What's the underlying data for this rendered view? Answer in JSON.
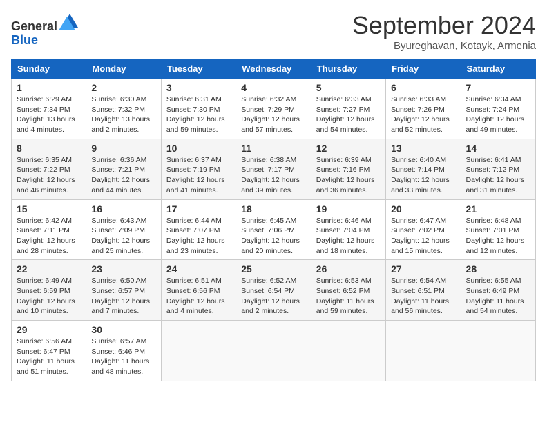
{
  "header": {
    "logo_line1": "General",
    "logo_line2": "Blue",
    "month_year": "September 2024",
    "location": "Byureghavan, Kotayk, Armenia"
  },
  "weekdays": [
    "Sunday",
    "Monday",
    "Tuesday",
    "Wednesday",
    "Thursday",
    "Friday",
    "Saturday"
  ],
  "weeks": [
    [
      {
        "day": "1",
        "sunrise": "6:29 AM",
        "sunset": "7:34 PM",
        "daylight": "13 hours and 4 minutes."
      },
      {
        "day": "2",
        "sunrise": "6:30 AM",
        "sunset": "7:32 PM",
        "daylight": "13 hours and 2 minutes."
      },
      {
        "day": "3",
        "sunrise": "6:31 AM",
        "sunset": "7:30 PM",
        "daylight": "12 hours and 59 minutes."
      },
      {
        "day": "4",
        "sunrise": "6:32 AM",
        "sunset": "7:29 PM",
        "daylight": "12 hours and 57 minutes."
      },
      {
        "day": "5",
        "sunrise": "6:33 AM",
        "sunset": "7:27 PM",
        "daylight": "12 hours and 54 minutes."
      },
      {
        "day": "6",
        "sunrise": "6:33 AM",
        "sunset": "7:26 PM",
        "daylight": "12 hours and 52 minutes."
      },
      {
        "day": "7",
        "sunrise": "6:34 AM",
        "sunset": "7:24 PM",
        "daylight": "12 hours and 49 minutes."
      }
    ],
    [
      {
        "day": "8",
        "sunrise": "6:35 AM",
        "sunset": "7:22 PM",
        "daylight": "12 hours and 46 minutes."
      },
      {
        "day": "9",
        "sunrise": "6:36 AM",
        "sunset": "7:21 PM",
        "daylight": "12 hours and 44 minutes."
      },
      {
        "day": "10",
        "sunrise": "6:37 AM",
        "sunset": "7:19 PM",
        "daylight": "12 hours and 41 minutes."
      },
      {
        "day": "11",
        "sunrise": "6:38 AM",
        "sunset": "7:17 PM",
        "daylight": "12 hours and 39 minutes."
      },
      {
        "day": "12",
        "sunrise": "6:39 AM",
        "sunset": "7:16 PM",
        "daylight": "12 hours and 36 minutes."
      },
      {
        "day": "13",
        "sunrise": "6:40 AM",
        "sunset": "7:14 PM",
        "daylight": "12 hours and 33 minutes."
      },
      {
        "day": "14",
        "sunrise": "6:41 AM",
        "sunset": "7:12 PM",
        "daylight": "12 hours and 31 minutes."
      }
    ],
    [
      {
        "day": "15",
        "sunrise": "6:42 AM",
        "sunset": "7:11 PM",
        "daylight": "12 hours and 28 minutes."
      },
      {
        "day": "16",
        "sunrise": "6:43 AM",
        "sunset": "7:09 PM",
        "daylight": "12 hours and 25 minutes."
      },
      {
        "day": "17",
        "sunrise": "6:44 AM",
        "sunset": "7:07 PM",
        "daylight": "12 hours and 23 minutes."
      },
      {
        "day": "18",
        "sunrise": "6:45 AM",
        "sunset": "7:06 PM",
        "daylight": "12 hours and 20 minutes."
      },
      {
        "day": "19",
        "sunrise": "6:46 AM",
        "sunset": "7:04 PM",
        "daylight": "12 hours and 18 minutes."
      },
      {
        "day": "20",
        "sunrise": "6:47 AM",
        "sunset": "7:02 PM",
        "daylight": "12 hours and 15 minutes."
      },
      {
        "day": "21",
        "sunrise": "6:48 AM",
        "sunset": "7:01 PM",
        "daylight": "12 hours and 12 minutes."
      }
    ],
    [
      {
        "day": "22",
        "sunrise": "6:49 AM",
        "sunset": "6:59 PM",
        "daylight": "12 hours and 10 minutes."
      },
      {
        "day": "23",
        "sunrise": "6:50 AM",
        "sunset": "6:57 PM",
        "daylight": "12 hours and 7 minutes."
      },
      {
        "day": "24",
        "sunrise": "6:51 AM",
        "sunset": "6:56 PM",
        "daylight": "12 hours and 4 minutes."
      },
      {
        "day": "25",
        "sunrise": "6:52 AM",
        "sunset": "6:54 PM",
        "daylight": "12 hours and 2 minutes."
      },
      {
        "day": "26",
        "sunrise": "6:53 AM",
        "sunset": "6:52 PM",
        "daylight": "11 hours and 59 minutes."
      },
      {
        "day": "27",
        "sunrise": "6:54 AM",
        "sunset": "6:51 PM",
        "daylight": "11 hours and 56 minutes."
      },
      {
        "day": "28",
        "sunrise": "6:55 AM",
        "sunset": "6:49 PM",
        "daylight": "11 hours and 54 minutes."
      }
    ],
    [
      {
        "day": "29",
        "sunrise": "6:56 AM",
        "sunset": "6:47 PM",
        "daylight": "11 hours and 51 minutes."
      },
      {
        "day": "30",
        "sunrise": "6:57 AM",
        "sunset": "6:46 PM",
        "daylight": "11 hours and 48 minutes."
      },
      null,
      null,
      null,
      null,
      null
    ]
  ]
}
